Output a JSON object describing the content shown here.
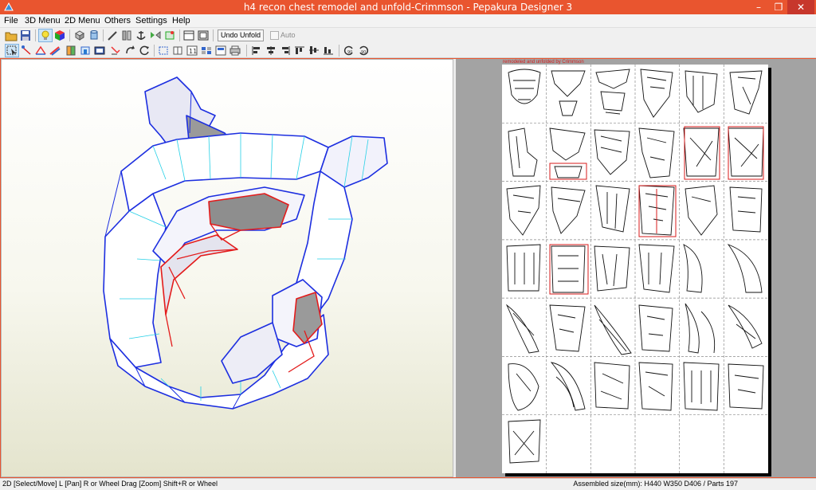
{
  "window": {
    "title": "h4 recon chest remodel and unfold-Crimmson - Pepakura Designer 3",
    "minimize_glyph": "–",
    "maximize_glyph": "❐",
    "close_glyph": "✕"
  },
  "menu": {
    "items": [
      "File",
      "3D Menu",
      "2D Menu",
      "Others",
      "Settings",
      "Help"
    ]
  },
  "toolbar": {
    "undo_unfold_label": "Undo Unfold",
    "auto_label": "Auto",
    "auto_checked": false,
    "row1_icons": [
      "open-icon",
      "save-icon",
      "lightbulb-icon",
      "texture-cube-icon",
      "cube-outline-icon",
      "cylinder-icon",
      "pen-icon",
      "join-icon",
      "anchor-icon",
      "flip-icon",
      "window-icon",
      "window-frame-icon"
    ],
    "row2_icons": [
      "select-icon",
      "pan-icon",
      "fold-icon",
      "edge-icon",
      "part-icon",
      "flap-icon",
      "image-icon",
      "move-edge-icon",
      "rotate-icon",
      "refresh-icon",
      "align-icon",
      "move-icon",
      "number-icon",
      "layout-icon",
      "print-icon",
      "align-left-icon",
      "align-center-icon",
      "align-right-icon",
      "align-top-icon",
      "align-middle-icon",
      "align-bottom-icon",
      "rotate-left-icon",
      "rotate-right-icon"
    ]
  },
  "paper": {
    "credit": "remodeled and unfolded by Crimmson",
    "columns": 6,
    "rows": 7,
    "highlighted_cells": [
      "1-4",
      "1-5",
      "1-1",
      "2-3",
      "3-1"
    ]
  },
  "colors": {
    "titlebar": "#e9552f",
    "edge_blue": "#1c2ee0",
    "edge_cyan": "#25d0e6",
    "fold_red": "#e31b1b",
    "paper_bg": "#a3a3a3"
  },
  "status": {
    "left": "2D [Select/Move] L [Pan] R or Wheel Drag [Zoom] Shift+R or Wheel",
    "right": "Assembled size(mm): H440 W350 D406 / Parts 197"
  }
}
